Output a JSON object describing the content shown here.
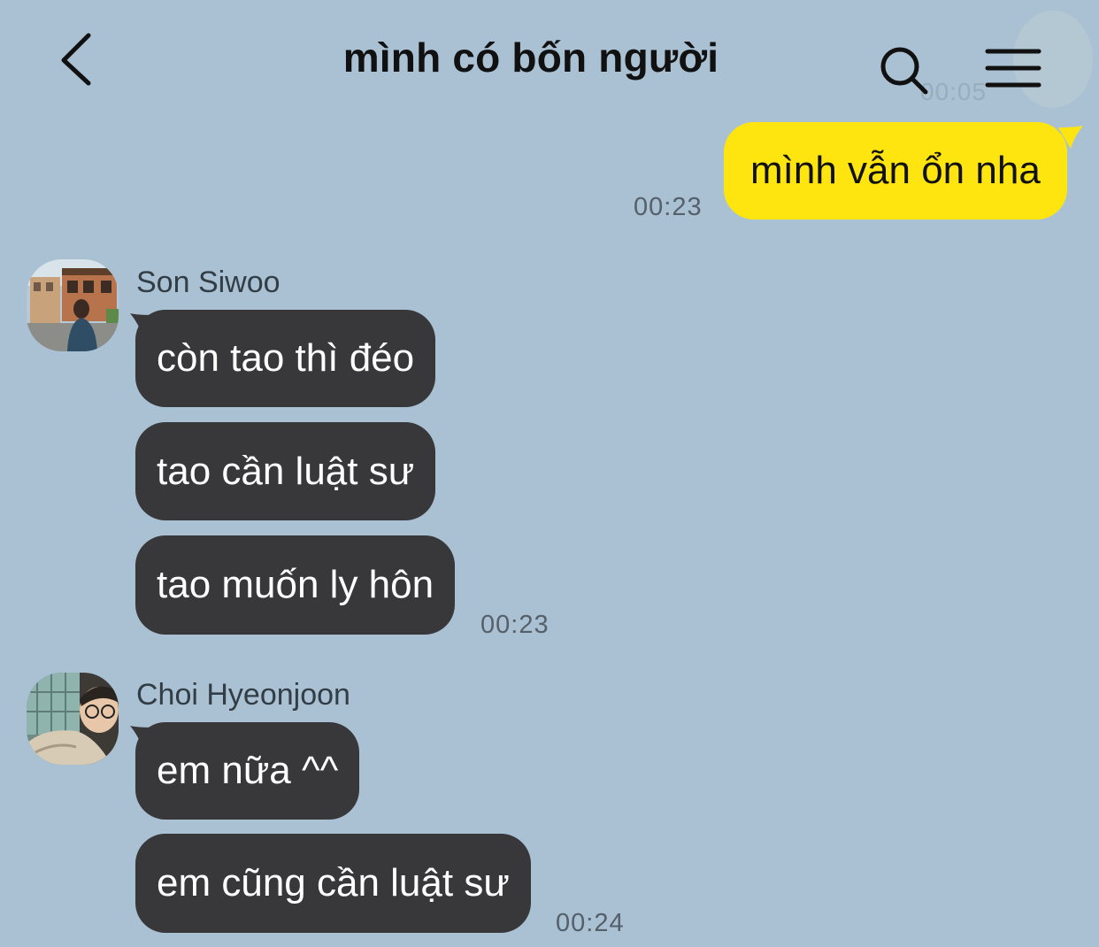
{
  "header": {
    "title": "mình có bốn người",
    "back_icon": "chevron-left-icon",
    "search_icon": "search-icon",
    "menu_icon": "hamburger-menu-icon",
    "ghost_time": "00:05"
  },
  "colors": {
    "background": "#a9c1d3",
    "my_bubble": "#fee50f",
    "other_bubble": "#38383b",
    "time_text": "#55606a"
  },
  "messages": {
    "mine": {
      "text": "mình vẫn ổn nha",
      "time": "00:23"
    },
    "group1": {
      "sender": "Son Siwoo",
      "bubbles": [
        "còn tao thì đéo",
        "tao cần luật sư",
        "tao muốn ly hôn"
      ],
      "time": "00:23"
    },
    "group2": {
      "sender": "Choi Hyeonjoon",
      "bubbles": [
        "em nữa ^^",
        "em cũng cần luật sư"
      ],
      "time": "00:24"
    }
  }
}
